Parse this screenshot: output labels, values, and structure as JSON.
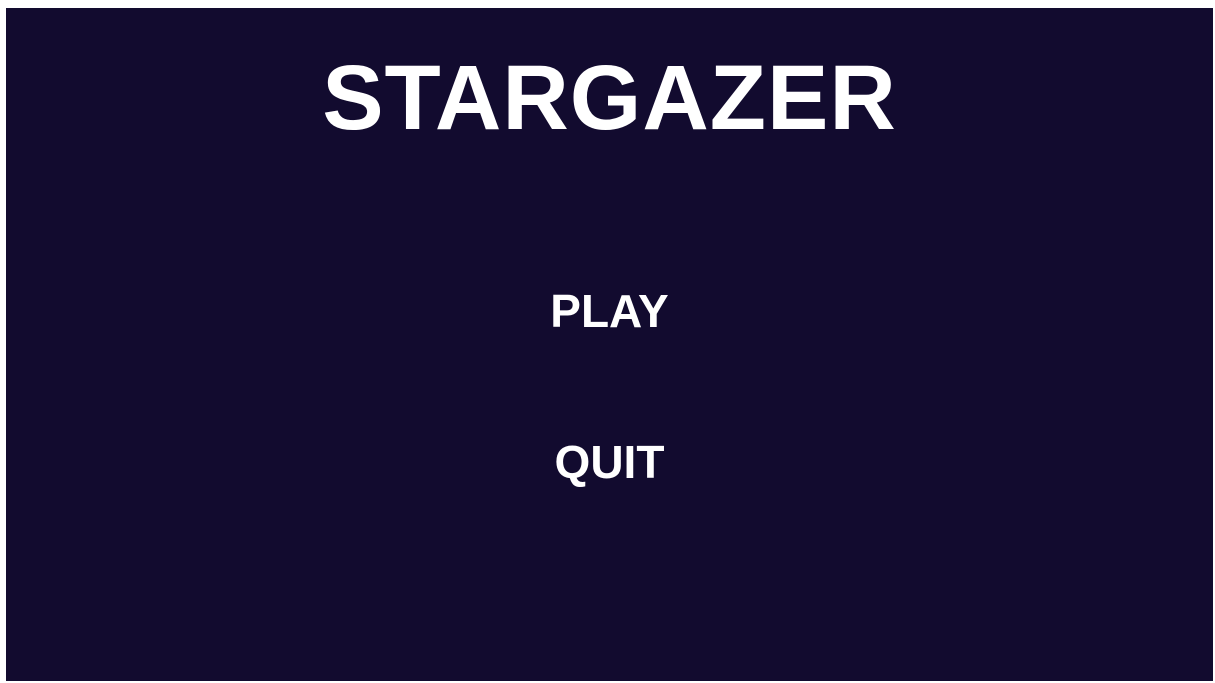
{
  "game": {
    "title": "STARGAZER",
    "menu": {
      "play_label": "PLAY",
      "quit_label": "QUIT"
    }
  },
  "colors": {
    "background": "#120b2f",
    "text": "#ffffff"
  }
}
